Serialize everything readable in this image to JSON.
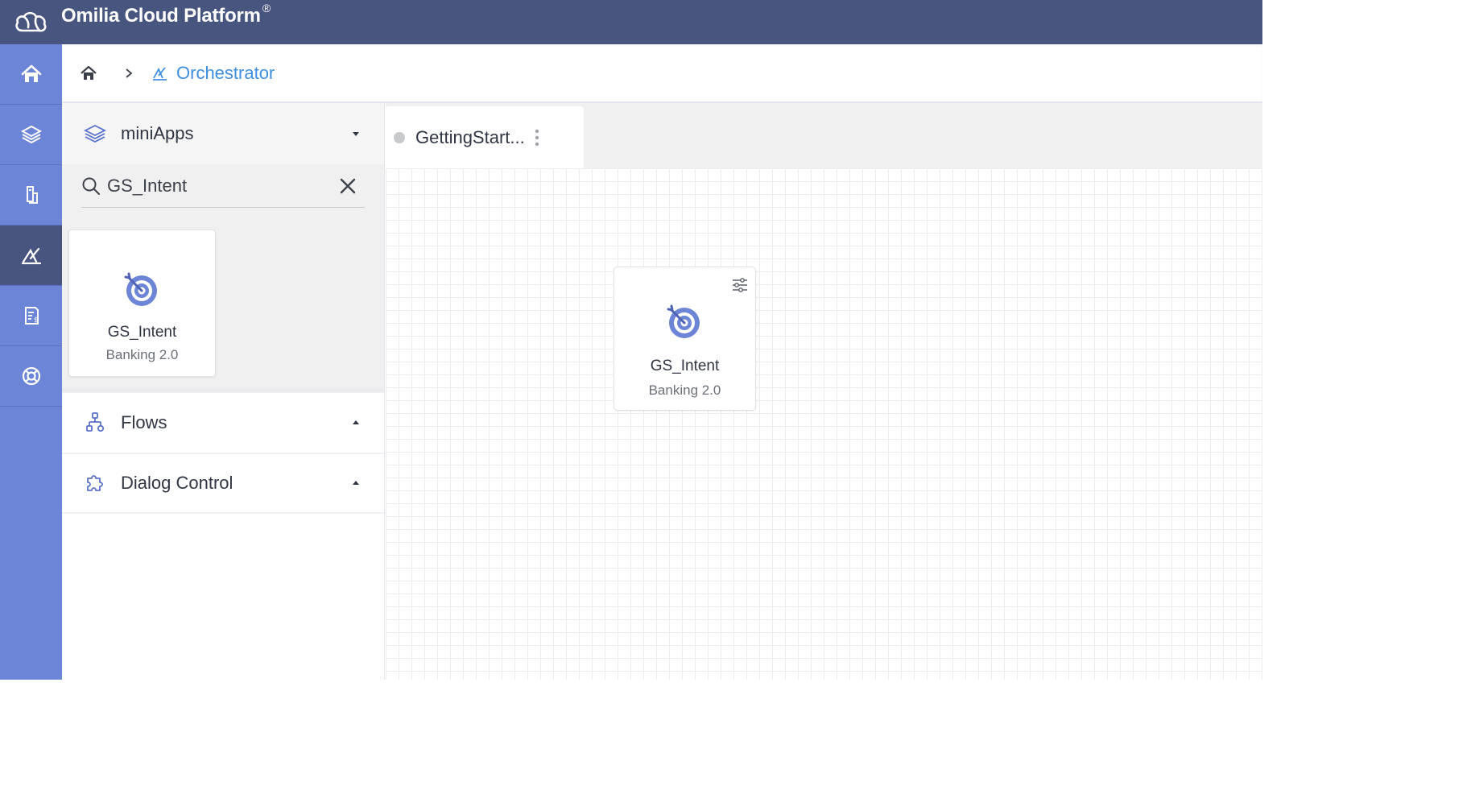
{
  "app": {
    "title": "Omilia Cloud Platform",
    "trademark": "®"
  },
  "rail": {
    "items": [
      {
        "name": "home-icon",
        "active": false
      },
      {
        "name": "layers-icon",
        "active": false
      },
      {
        "name": "deploy-icon",
        "active": false
      },
      {
        "name": "orchestrator-icon",
        "active": true
      },
      {
        "name": "billing-icon",
        "active": false
      },
      {
        "name": "support-icon",
        "active": false
      }
    ]
  },
  "breadcrumb": {
    "current": "Orchestrator"
  },
  "panel": {
    "miniapps_label": "miniApps",
    "search": {
      "value": "GS_Intent",
      "placeholder": ""
    },
    "results": [
      {
        "name": "GS_Intent",
        "subtitle": "Banking 2.0"
      }
    ],
    "flows_label": "Flows",
    "dialog_control_label": "Dialog Control"
  },
  "tabs": [
    {
      "label": "GettingStart..."
    }
  ],
  "canvas": {
    "node": {
      "name": "GS_Intent",
      "subtitle": "Banking 2.0"
    }
  },
  "colors": {
    "topbar": "#48557f",
    "rail": "#6d85d6",
    "rail_active": "#48557f",
    "accent": "#3f8fe0",
    "icon_blue": "#5b72c9"
  }
}
